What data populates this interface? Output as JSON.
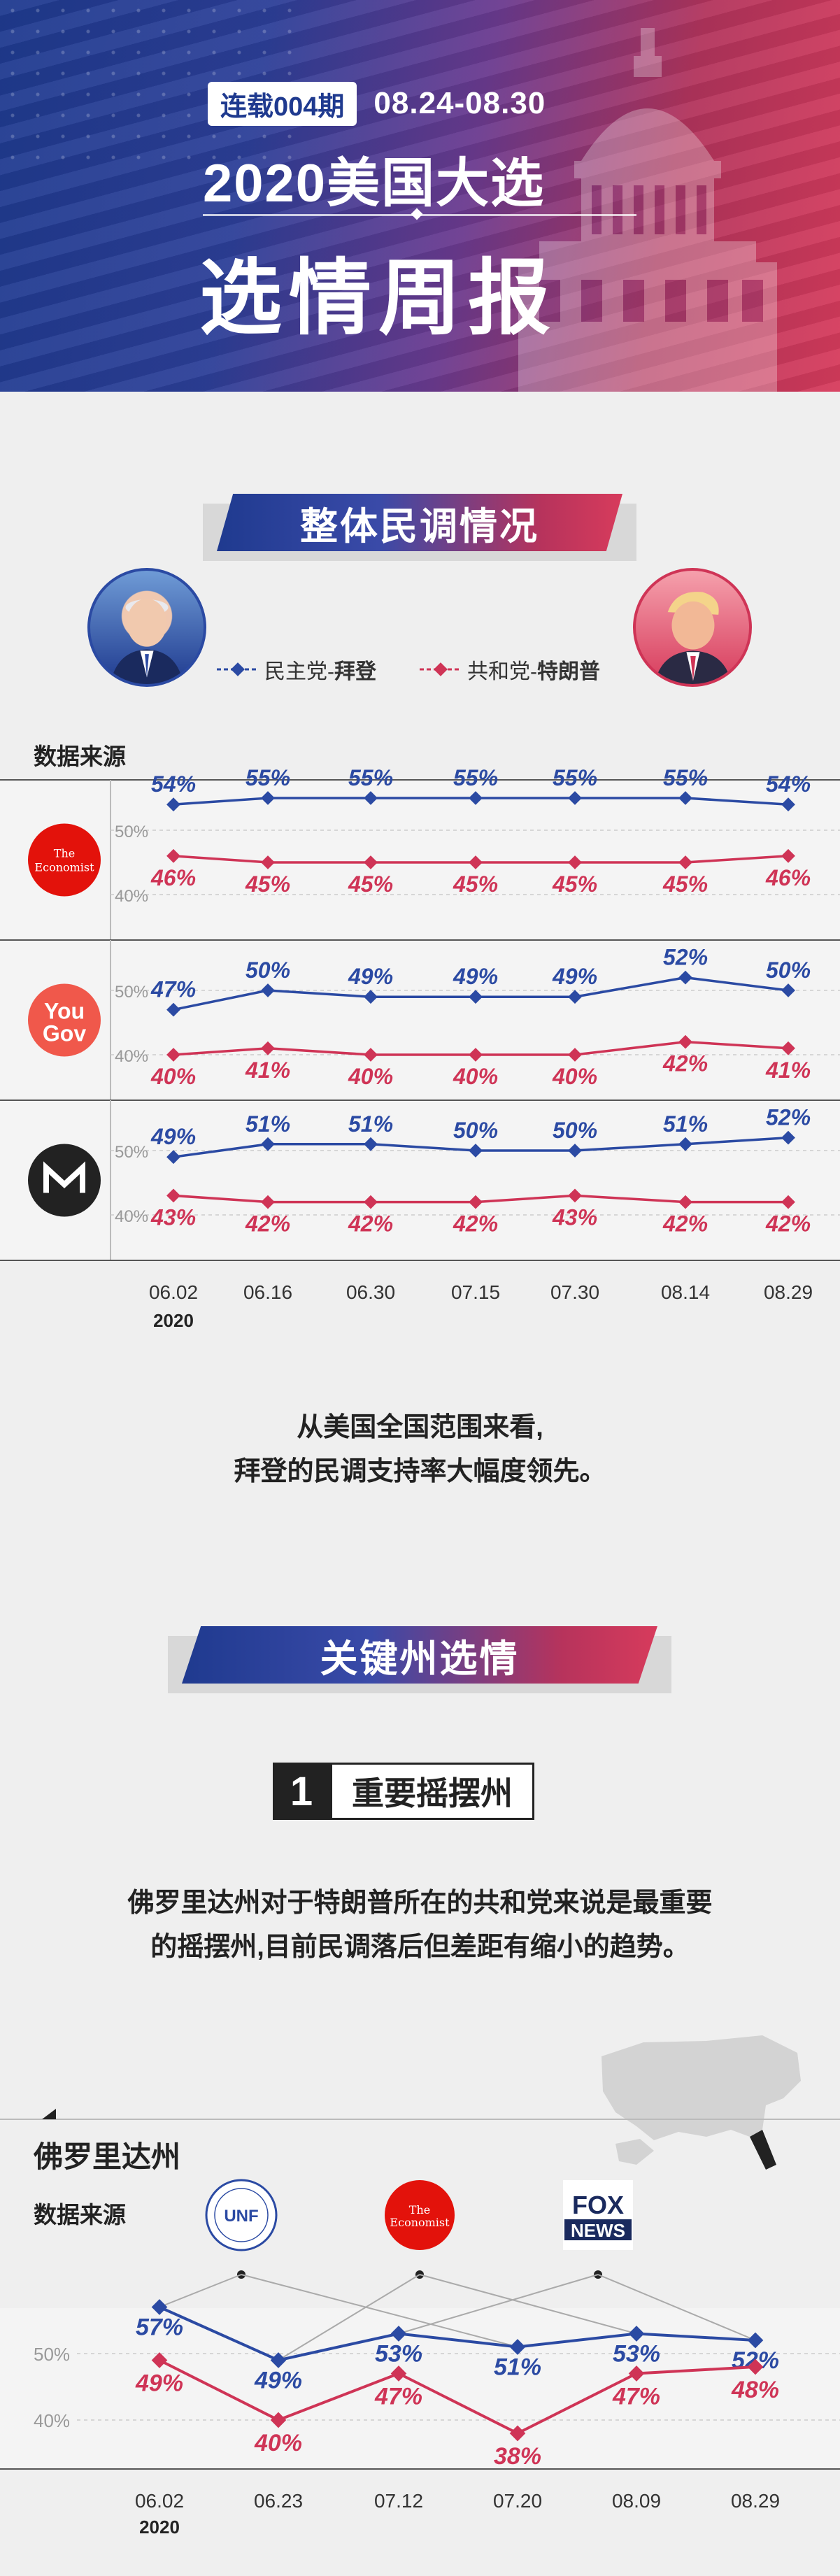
{
  "header": {
    "issue_badge": "连载004期",
    "dates": "08.24-08.30",
    "title_line1": "2020美国大选",
    "title_line2": "选情周报"
  },
  "section1": {
    "title": "整体民调情况"
  },
  "legend": {
    "dem_party": "民主党-",
    "dem_name": "拜登",
    "rep_party": "共和党-",
    "rep_name": "特朗普",
    "dem_color": "#2b4aa3",
    "rep_color": "#cf3456"
  },
  "data_source_label": "数据来源",
  "poll_sources": [
    {
      "name": "The Economist",
      "logo_text": [
        "The",
        "Economist"
      ],
      "logo_color": "#e3120b",
      "icon": "economist-logo"
    },
    {
      "name": "YouGov",
      "logo_text": [
        "You",
        "Gov"
      ],
      "logo_color": "#f0584b",
      "icon": "yougov-logo"
    },
    {
      "name": "Morning Consult",
      "logo_text": [
        "M"
      ],
      "logo_color": "#222222",
      "icon": "morning-consult-logo"
    }
  ],
  "chart_data": [
    {
      "type": "line",
      "x": [
        "06.02",
        "06.16",
        "06.30",
        "07.15",
        "07.30",
        "08.14",
        "08.29"
      ],
      "x_year_label": "2020",
      "ylim": [
        30,
        60
      ],
      "y_ticks": [
        "50%",
        "40%"
      ],
      "panels": [
        {
          "source": "The Economist",
          "series": [
            {
              "name": "拜登",
              "values": [
                54,
                55,
                55,
                55,
                55,
                55,
                54
              ]
            },
            {
              "name": "特朗普",
              "values": [
                46,
                45,
                45,
                45,
                45,
                45,
                46
              ]
            }
          ]
        },
        {
          "source": "YouGov",
          "series": [
            {
              "name": "拜登",
              "values": [
                47,
                50,
                49,
                49,
                49,
                52,
                50
              ]
            },
            {
              "name": "特朗普",
              "values": [
                40,
                41,
                40,
                40,
                40,
                42,
                41
              ]
            }
          ]
        },
        {
          "source": "Morning Consult",
          "series": [
            {
              "name": "拜登",
              "values": [
                49,
                51,
                51,
                50,
                50,
                51,
                52
              ]
            },
            {
              "name": "特朗普",
              "values": [
                43,
                42,
                42,
                42,
                43,
                42,
                42
              ]
            }
          ]
        }
      ]
    },
    {
      "type": "line",
      "title": "佛罗里达州",
      "x": [
        "06.02",
        "06.23",
        "07.12",
        "07.20",
        "08.09",
        "08.29"
      ],
      "x_year_label": "2020",
      "y_ticks": [
        "50%",
        "40%"
      ],
      "sources": [
        "University of North Florida",
        "The Economist",
        "Fox News"
      ],
      "point_sources": [
        0,
        1,
        2,
        0,
        1,
        2
      ],
      "series": [
        {
          "name": "拜登",
          "values": [
            57,
            49,
            53,
            51,
            53,
            52
          ]
        },
        {
          "name": "特朗普",
          "values": [
            49,
            40,
            47,
            38,
            47,
            48
          ]
        }
      ]
    }
  ],
  "summary": {
    "line1": "从美国全国范围来看,",
    "line2": "拜登的民调支持率大幅度领先。"
  },
  "section2": {
    "title": "关键州选情"
  },
  "swing": {
    "number": "1",
    "label": "重要摇摆州",
    "desc_line1": "佛罗里达州对于特朗普所在的共和党来说是最重要",
    "desc_line2": "的摇摆州,目前民调落后但差距有缩小的趋势。"
  },
  "florida": {
    "title": "佛罗里达州",
    "source_label": "数据来源",
    "logos": [
      {
        "name": "University of North Florida",
        "text": "UNF",
        "icon": "unf-seal-logo"
      },
      {
        "name": "The Economist",
        "text": [
          "The",
          "Economist"
        ],
        "icon": "economist-logo"
      },
      {
        "name": "Fox News",
        "text": [
          "FOX",
          "NEWS"
        ],
        "icon": "fox-news-logo"
      }
    ]
  }
}
